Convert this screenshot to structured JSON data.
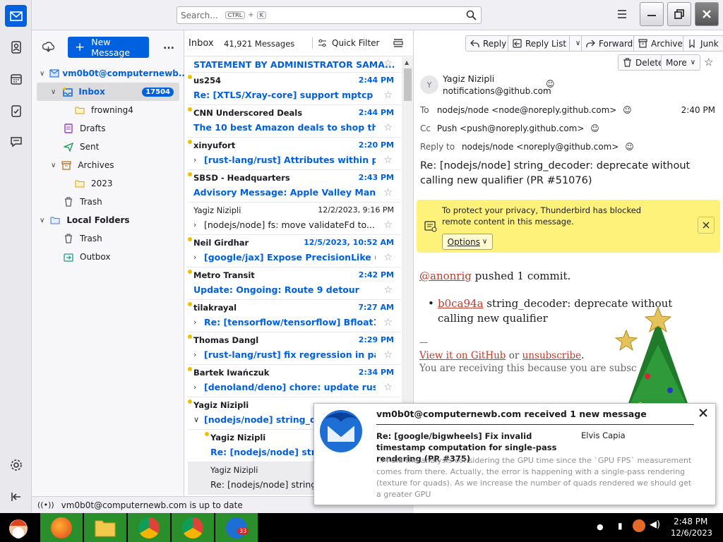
{
  "search": {
    "placeholder": "Search...",
    "key1": "CTRL",
    "plus": "+",
    "key2": "K"
  },
  "spaces": [
    "mail-icon",
    "address-book-icon",
    "calendar-icon",
    "tasks-icon",
    "chat-icon",
    "settings-icon",
    "collapse-icon"
  ],
  "folder_pane": {
    "new_message": "New Message",
    "more": "...",
    "account": "vm0b0t@computernewb...",
    "folders": [
      {
        "name": "Inbox",
        "badge": "17504",
        "icon": "inbox-icon"
      },
      {
        "name": "frowning4",
        "icon": "folder-icon"
      },
      {
        "name": "Drafts",
        "icon": "drafts-icon"
      },
      {
        "name": "Sent",
        "icon": "sent-icon"
      },
      {
        "name": "Archives",
        "icon": "archive-icon"
      },
      {
        "name": "2023",
        "icon": "folder-icon"
      },
      {
        "name": "Trash",
        "icon": "trash-icon"
      },
      {
        "name": "Local Folders",
        "icon": "folder-icon"
      },
      {
        "name": "Trash",
        "icon": "trash-icon"
      },
      {
        "name": "Outbox",
        "icon": "outbox-icon"
      }
    ]
  },
  "thread_pane": {
    "title": "Inbox",
    "count": "41,921 Messages",
    "quick_filter": "Quick Filter",
    "banner_subject": "STATEMENT BY ADMINISTRATOR SAMA...",
    "messages": [
      {
        "sender": "us254",
        "date": "2:44 PM",
        "subject": "Re: [XTLS/Xray-core] support mptcp (P...",
        "unread": true,
        "thread": false
      },
      {
        "sender": "CNN Underscored Deals",
        "date": "2:44 PM",
        "subject": "The 10 best Amazon deals to shop this ...",
        "unread": true,
        "thread": false
      },
      {
        "sender": "xinyufort",
        "date": "2:20 PM",
        "subject": "[rust-lang/rust] Attributes within pat...",
        "unread": true,
        "thread": true
      },
      {
        "sender": "SBSD - Headquarters",
        "date": "2:43 PM",
        "subject": "Advisory Message: Apple Valley Man Ar...",
        "unread": true,
        "thread": false
      },
      {
        "sender": "Yagiz Nizipli",
        "date": "12/2/2023, 9:16 PM",
        "subject": "[nodejs/node] fs: move validateFd to...",
        "unread": false,
        "thread": true
      },
      {
        "sender": "Neil Girdhar",
        "date": "12/5/2023, 10:52 AM",
        "subject": "[google/jax] Expose PrecisionLike (P...",
        "unread": true,
        "thread": true
      },
      {
        "sender": "Metro Transit",
        "date": "2:42 PM",
        "subject": "Update: Ongoing: Route 9 detour",
        "unread": true,
        "thread": false
      },
      {
        "sender": "tilakrayal",
        "date": "7:27 AM",
        "subject": "Re: [tensorflow/tensorflow] Bfloat16 ...",
        "unread": true,
        "thread": true
      },
      {
        "sender": "Thomas Dangl",
        "date": "2:29 PM",
        "subject": "[rust-lang/rust] fix regression in pani...",
        "unread": true,
        "thread": true
      },
      {
        "sender": "Bartek Iwańczuk",
        "date": "2:34 PM",
        "subject": "[denoland/deno] chore: update rusty...",
        "unread": true,
        "thread": true
      },
      {
        "sender": "Yagiz Nizipli",
        "date": "",
        "subject": "[nodejs/node] string_dec",
        "unread": true,
        "thread": true,
        "open": true
      },
      {
        "sender": "Yagiz Nizipli",
        "date": "",
        "subject": "Re: [nodejs/node] string",
        "unread": true,
        "child": true
      },
      {
        "sender": "Yagiz Nizipli",
        "date": "",
        "subject": "Re: [nodejs/node] string_",
        "unread": false,
        "child": true,
        "selected": true
      }
    ]
  },
  "reader": {
    "buttons": {
      "reply": "Reply",
      "reply_list": "Reply List",
      "forward": "Forward",
      "archive": "Archive",
      "junk": "Junk",
      "delete": "Delete",
      "more": "More"
    },
    "from_name": "Yagiz Nizipli",
    "from_email": "notifications@github.com",
    "avatar": "Y",
    "to_label": "To",
    "to": "nodejs/node <node@noreply.github.com>",
    "time": "2:40 PM",
    "cc_label": "Cc",
    "cc": "Push <push@noreply.github.com>",
    "replyto_label": "Reply to",
    "replyto": "nodejs/node <noreply@github.com>",
    "subject": "Re: [nodejs/node] string_decoder: deprecate without calling new qualifier (PR #51076)",
    "notice_text": "To protect your privacy, Thunderbird has blocked remote content in this message.",
    "notice_options": "Options",
    "body_user": "@anonrig",
    "body_pushed": " pushed 1 commit.",
    "commit_hash": "b0ca94a",
    "commit_msg": " string_decoder: deprecate without calling new qualifier",
    "sep": "—",
    "view_link": "View it on GitHub",
    "or": " or ",
    "unsub": "unsubscribe",
    "period": ".",
    "receiving": "You are receiving this because you are subsc"
  },
  "status": {
    "text": "vm0b0t@computernewb.com is up to date"
  },
  "popup": {
    "title": "vm0b0t@computernewb.com received 1 new message",
    "subject": "Re: [google/bigwheels] Fix invalid timestamp computation for single-pass rendering (PR #375)",
    "sender": "Elvis Capia",
    "preview": "... I did the analysis considering the GPU time since the `GPU FPS` measurement comes from there. Actually, the error is happening with a single-pass rendering (texture for quads). As we increase the number of quads rendered we should get a greater GPU"
  },
  "taskbar": {
    "time": "2:48 PM",
    "date": "12/6/2023",
    "mail_badge": "33"
  },
  "colors": {
    "accent": "#0061e0",
    "notice": "#fff27a",
    "taskbar_green": "#2a8f2a"
  }
}
